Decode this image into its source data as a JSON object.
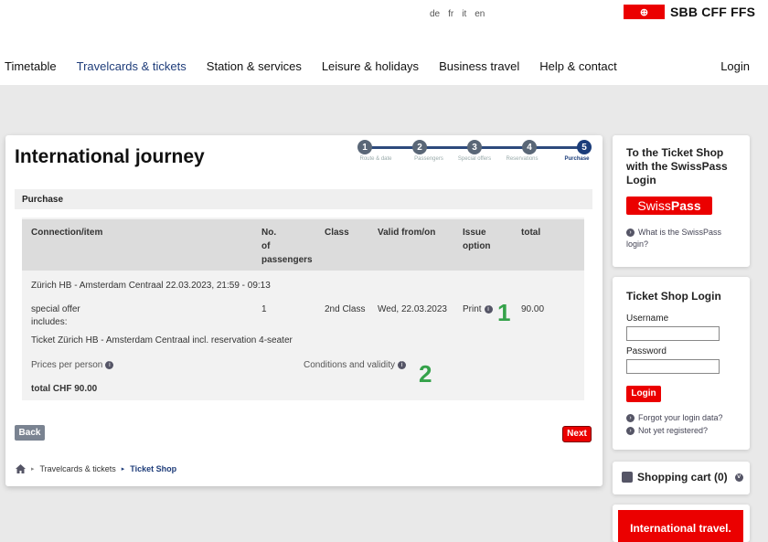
{
  "header": {
    "languages": [
      "de",
      "fr",
      "it",
      "en"
    ],
    "logo_flag": "⊕",
    "logo_text": "SBB CFF FFS",
    "nav": [
      "Timetable",
      "Travelcards & tickets",
      "Station & services",
      "Leisure & holidays",
      "Business travel",
      "Help & contact"
    ],
    "login": "Login"
  },
  "main": {
    "title": "International journey",
    "steps": [
      {
        "num": "1",
        "label": "Route & date"
      },
      {
        "num": "2",
        "label": "Passengers"
      },
      {
        "num": "3",
        "label": "Special offers"
      },
      {
        "num": "4",
        "label": "Reservations"
      },
      {
        "num": "5",
        "label": "Purchase"
      }
    ],
    "section": "Purchase",
    "table": {
      "headers": {
        "item": "Connection/item",
        "passengers_1": "No.",
        "passengers_2": "of",
        "passengers_3": "passengers",
        "class": "Class",
        "valid": "Valid from/on",
        "issue_1": "Issue",
        "issue_2": "option",
        "total": "total"
      },
      "connection": "Zürich HB - Amsterdam Centraal 22.03.2023, 21:59 - 09:13",
      "row": {
        "item": "special offer",
        "includes": "includes:",
        "passengers": "1",
        "class": "2nd Class",
        "valid": "Wed, 22.03.2023",
        "issue": "Print",
        "total": "90.00"
      },
      "ticket_desc": "Ticket Zürich HB - Amsterdam Centraal incl. reservation 4-seater",
      "prices_per_person": "Prices per person",
      "conditions": "Conditions and validity",
      "grand_total": "total CHF 90.00"
    },
    "annotations": [
      "1",
      "2"
    ],
    "back": "Back",
    "next": "Next",
    "breadcrumb": [
      "Travelcards & tickets",
      "Ticket Shop"
    ]
  },
  "sidebar": {
    "swisspass_card": {
      "title": "To the Ticket Shop with the SwissPass Login",
      "badge_a": "Swiss",
      "badge_b": "Pass",
      "link": "What is the SwissPass login?"
    },
    "login_card": {
      "title": "Ticket Shop Login",
      "username_label": "Username",
      "password_label": "Password",
      "button": "Login",
      "forgot": "Forgot your login data?",
      "register": "Not yet registered?"
    },
    "cart": "Shopping cart (0)",
    "banner": "International travel."
  },
  "colors": {
    "brand_red": "#eb0000",
    "nav_blue": "#1f3d7a",
    "highlight_green": "#35a24a"
  }
}
